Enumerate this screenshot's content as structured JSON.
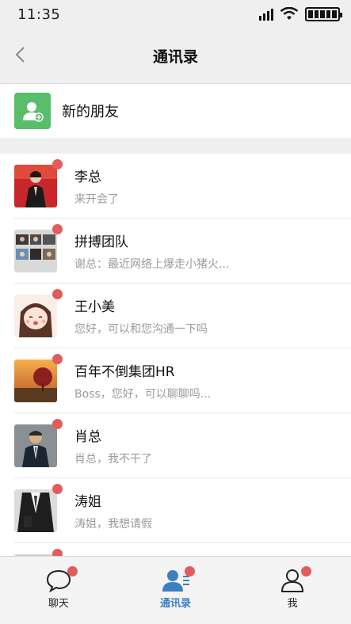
{
  "status_bar": {
    "time": "11:35"
  },
  "nav": {
    "title": "通讯录"
  },
  "new_friends": {
    "label": "新的朋友"
  },
  "contacts": [
    {
      "name": "李总",
      "message": "来开会了",
      "has_unread": true
    },
    {
      "name": "拼搏团队",
      "message": "谢总：最近网络上爆走小猪火...",
      "has_unread": true
    },
    {
      "name": "王小美",
      "message": "您好，可以和您沟通一下吗",
      "has_unread": true
    },
    {
      "name": "百年不倒集团HR",
      "message": "Boss，您好，可以聊聊吗...",
      "has_unread": true
    },
    {
      "name": "肖总",
      "message": "肖总，我不干了",
      "has_unread": true
    },
    {
      "name": "涛姐",
      "message": "涛姐，我想请假",
      "has_unread": true
    }
  ],
  "tabs": [
    {
      "label": "聊天",
      "active": false,
      "has_badge": true
    },
    {
      "label": "通讯录",
      "active": true,
      "has_badge": true
    },
    {
      "label": "我",
      "active": false,
      "has_badge": true
    }
  ],
  "colors": {
    "accent": "#3d7fc1",
    "badge": "#e25c5c",
    "new_friend_bg": "#58be6a",
    "nav_bg": "#efefef"
  }
}
